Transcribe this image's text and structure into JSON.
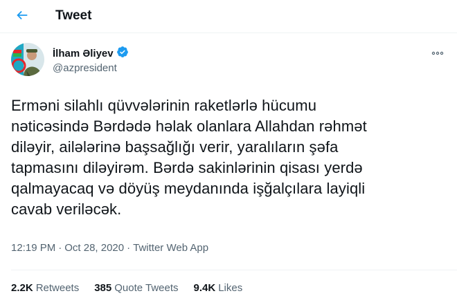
{
  "header": {
    "title": "Tweet",
    "back_icon": "arrow-left-icon",
    "accent": "#1d9bf0"
  },
  "author": {
    "name": "İlham Əliyev",
    "handle": "@azpresident",
    "verified": true,
    "verified_color": "#1d9bf0",
    "more_icon": "more-dots-icon"
  },
  "tweet": {
    "lines": [
      "Erməni silahlı qüvvələrinin raketlərlə hücumu",
      "nəticəsində Bərdədə həlak olanlara Allahdan rəhmət",
      "diləyir, ailələrinə başsağlığı verir, yaralıların şəfa",
      "tapmasını diləyirəm. Bərdə sakinlərinin qisası yerdə",
      "qalmayacaq və döyüş meydanında işğalçılara layiqli",
      "cavab veriləcək."
    ]
  },
  "meta": {
    "time": "12:19 PM",
    "separator1": "·",
    "date": "Oct 28, 2020",
    "separator2": "·",
    "source": "Twitter Web App"
  },
  "stats": {
    "retweets_count": "2.2K",
    "retweets_label": "Retweets",
    "quotes_count": "385",
    "quotes_label": "Quote Tweets",
    "likes_count": "9.4K",
    "likes_label": "Likes"
  }
}
